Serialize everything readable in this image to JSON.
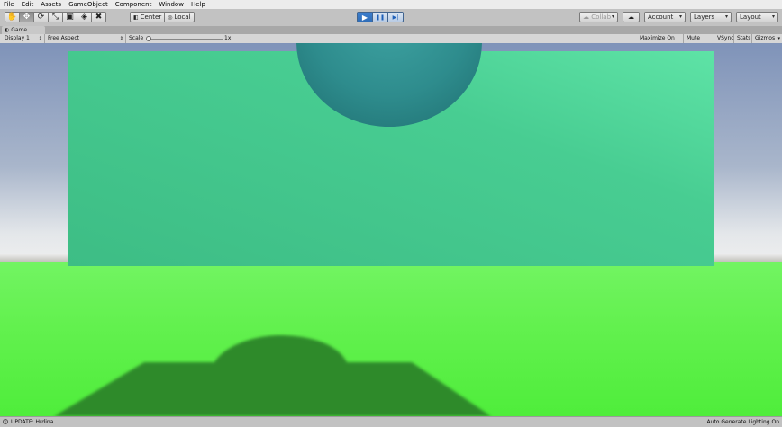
{
  "menu": [
    "File",
    "Edit",
    "Assets",
    "GameObject",
    "Component",
    "Window",
    "Help"
  ],
  "toolbar": {
    "tools": [
      {
        "icon": "hand-tool-icon",
        "glyph": "✋"
      },
      {
        "icon": "move-tool-icon",
        "glyph": "✥"
      },
      {
        "icon": "rotate-tool-icon",
        "glyph": "⟳"
      },
      {
        "icon": "scale-tool-icon",
        "glyph": "⤡"
      },
      {
        "icon": "rect-tool-icon",
        "glyph": "▣"
      },
      {
        "icon": "transform-tool-icon",
        "glyph": "◈"
      },
      {
        "icon": "custom-tool-icon",
        "glyph": "✖"
      }
    ],
    "active_tool_index": 1,
    "pivot_label": "Center",
    "rotation_label": "Local",
    "play_glyph": "▶",
    "pause_glyph": "❚❚",
    "step_glyph": "▶|",
    "collab_label": "Collab",
    "cloud_glyph": "☁",
    "account_label": "Account",
    "layers_label": "Layers",
    "layout_label": "Layout"
  },
  "game_window": {
    "tab_label": "Game",
    "display_label": "Display 1",
    "aspect_label": "Free Aspect",
    "scale_label": "Scale",
    "scale_value": "1x",
    "maximize_label": "Maximize On Play",
    "mute_label": "Mute Audio",
    "vsync_label": "VSync",
    "stats_label": "Stats",
    "gizmos_label": "Gizmos"
  },
  "scene_colors": {
    "wall": "#48cd92",
    "sphere": "#2e8c8d",
    "ground": "#63f14f",
    "shadow": "#2f8a2a",
    "sky": "#7f93b9"
  },
  "status": {
    "message": "UPDATE: Hrdina",
    "lighting": "Auto Generate Lighting On"
  }
}
